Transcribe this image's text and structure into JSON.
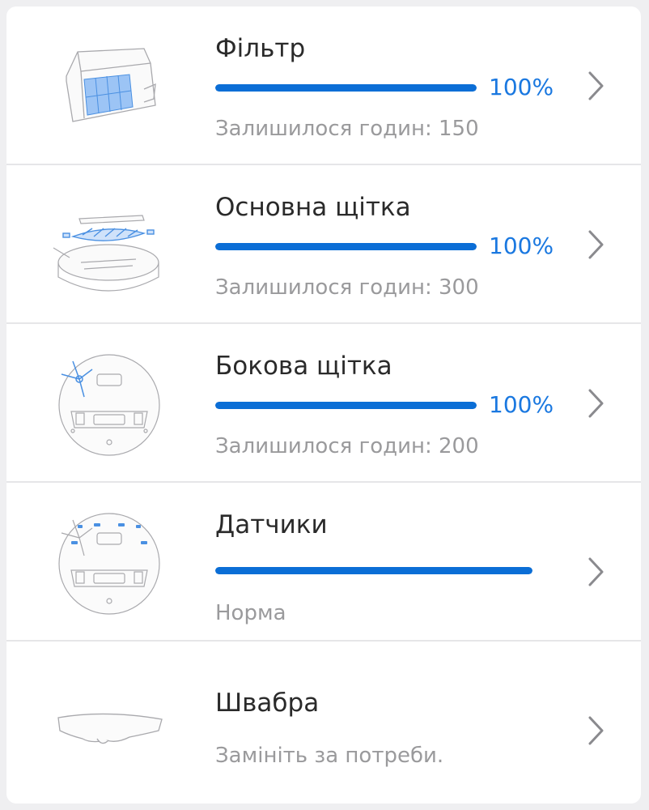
{
  "colors": {
    "accent": "#0b6ed6",
    "percent_text": "#1a78e0",
    "secondary_text": "#9a9a9c"
  },
  "items": [
    {
      "title": "Фільтр",
      "percent": "100%",
      "level": 1.0,
      "subtitle": "Залишилося годин: 150",
      "icon": "filter-icon"
    },
    {
      "title": "Основна щітка",
      "percent": "100%",
      "level": 1.0,
      "subtitle": "Залишилося годин: 300",
      "icon": "main-brush-icon"
    },
    {
      "title": "Бокова щітка",
      "percent": "100%",
      "level": 1.0,
      "subtitle": "Залишилося годин: 200",
      "icon": "side-brush-icon"
    },
    {
      "title": "Датчики",
      "level": 1.0,
      "subtitle": "Норма",
      "icon": "sensors-icon"
    },
    {
      "title": "Швабра",
      "subtitle": "Замініть за потреби.",
      "icon": "mop-icon"
    }
  ],
  "chevron_icon": "chevron-right-icon"
}
